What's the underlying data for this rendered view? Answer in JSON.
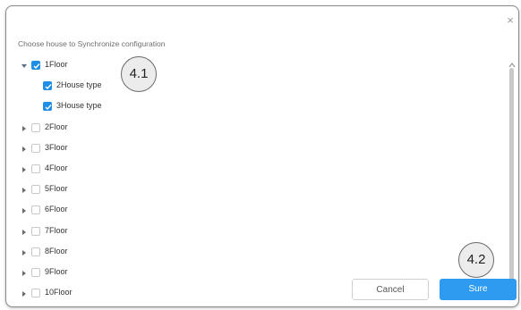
{
  "dialog": {
    "close_glyph": "×",
    "prompt": "Choose house to Synchronize configuration",
    "tree": [
      {
        "label": "1Floor",
        "level": 0,
        "expanded": true,
        "has_caret": true,
        "checked": true
      },
      {
        "label": "2House type",
        "level": 1,
        "has_caret": false,
        "checked": true
      },
      {
        "label": "3House type",
        "level": 1,
        "has_caret": false,
        "checked": true
      },
      {
        "label": "2Floor",
        "level": 0,
        "expanded": false,
        "has_caret": true,
        "checked": false
      },
      {
        "label": "3Floor",
        "level": 0,
        "expanded": false,
        "has_caret": true,
        "checked": false
      },
      {
        "label": "4Floor",
        "level": 0,
        "expanded": false,
        "has_caret": true,
        "checked": false
      },
      {
        "label": "5Floor",
        "level": 0,
        "expanded": false,
        "has_caret": true,
        "checked": false
      },
      {
        "label": "6Floor",
        "level": 0,
        "expanded": false,
        "has_caret": true,
        "checked": false
      },
      {
        "label": "7Floor",
        "level": 0,
        "expanded": false,
        "has_caret": true,
        "checked": false
      },
      {
        "label": "8Floor",
        "level": 0,
        "expanded": false,
        "has_caret": true,
        "checked": false
      },
      {
        "label": "9Floor",
        "level": 0,
        "expanded": false,
        "has_caret": true,
        "checked": false
      },
      {
        "label": "10Floor",
        "level": 0,
        "expanded": false,
        "has_caret": true,
        "checked": false
      }
    ],
    "cancel_label": "Cancel",
    "sure_label": "Sure"
  },
  "annotations": {
    "callout_1": "4.1",
    "callout_2": "4.2"
  },
  "colors": {
    "accent": "#2f9bf0",
    "checkbox_checked": "#1f8ee6",
    "callout_fill": "#ececec"
  },
  "icons": {
    "close": "close-icon",
    "expanded_caret": "caret-down-icon",
    "collapsed_caret": "caret-right-icon",
    "check": "check-icon",
    "scroll_up": "scroll-up-icon"
  }
}
